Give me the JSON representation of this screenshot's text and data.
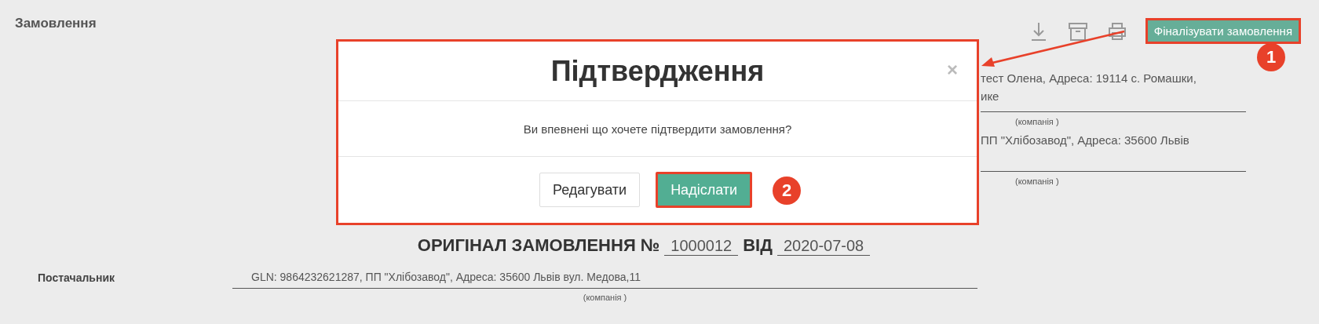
{
  "page": {
    "title": "Замовлення"
  },
  "toolbar": {
    "finalize_button": "Фіналізувати замовлення"
  },
  "parties": [
    {
      "lines": [
        "тест Олена, Адреса: 19114 с. Ромашки,",
        "ике"
      ],
      "caption": "(компанія )"
    },
    {
      "lines": [
        "ПП \"Хлібозавод\", Адреса: 35600 Львів"
      ],
      "caption": "(компанія )"
    }
  ],
  "heading": {
    "title": "ОРИГІНАЛ ЗАМОВЛЕННЯ №",
    "number": "1000012",
    "date_label": "ВІД",
    "date": "2020-07-08"
  },
  "fields": [
    {
      "label": "Постачальник",
      "value": "GLN: 9864232621287, ПП \"Хлібозавод\", Адреса: 35600 Львів вул. Медова,11",
      "caption": "(компанія )"
    }
  ],
  "modal": {
    "title": "Підтвердження",
    "close": "×",
    "message": "Ви впевнені що хочете підтвердити замовлення?",
    "buttons": [
      {
        "label": "Редагувати",
        "kind": "default"
      },
      {
        "label": "Надіслати",
        "kind": "primary"
      }
    ]
  },
  "callouts": [
    {
      "number": "1"
    },
    {
      "number": "2"
    }
  ]
}
